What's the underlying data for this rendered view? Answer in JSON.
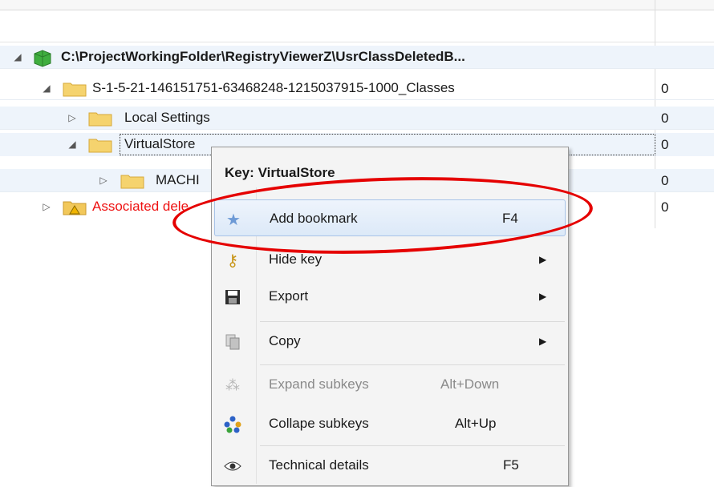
{
  "tree": {
    "root": {
      "label": "C:\\ProjectWorkingFolder\\RegistryViewerZ\\UsrClassDeletedB..."
    },
    "rows": [
      {
        "label": "S-1-5-21-146151751-63468248-1215037915-1000_Classes",
        "value": "0"
      },
      {
        "label": "Local Settings",
        "value": "0"
      },
      {
        "label": "VirtualStore",
        "value": "0"
      },
      {
        "label": "MACHI",
        "value": "0"
      },
      {
        "label": "Associated dele",
        "value": "0"
      }
    ]
  },
  "context_menu": {
    "title": "Key: VirtualStore",
    "items": [
      {
        "label": "Add bookmark",
        "shortcut": "F4",
        "icon": "star-icon"
      },
      {
        "label": "Hide key",
        "shortcut": "",
        "icon": "key-icon"
      },
      {
        "label": "Export",
        "shortcut": "",
        "icon": "save-icon"
      },
      {
        "label": "Copy",
        "shortcut": "",
        "icon": "copy-icon"
      },
      {
        "label": "Expand subkeys",
        "shortcut": "Alt+Down",
        "icon": "expand-subkeys-icon"
      },
      {
        "label": "Collape subkeys",
        "shortcut": "Alt+Up",
        "icon": "collapse-subkeys-icon"
      },
      {
        "label": "Technical details",
        "shortcut": "F5",
        "icon": "eye-icon"
      }
    ]
  },
  "colors": {
    "highlight_ellipse": "#e50000",
    "deleted_text": "#ee1111",
    "hover_border": "#a7c3e8"
  }
}
